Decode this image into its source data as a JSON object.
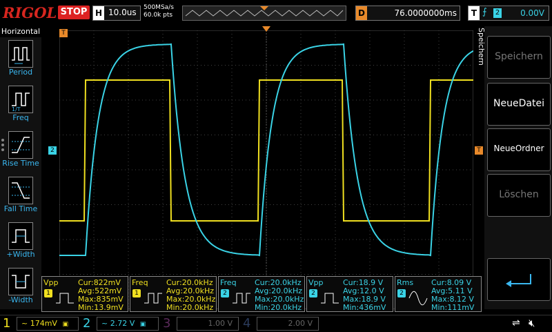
{
  "topbar": {
    "logo": "RIGOL",
    "run_state": "STOP",
    "h_label": "H",
    "timebase": "10.0us",
    "sample_rate": "500MSa/s",
    "sample_points": "60.0k pts",
    "d_label": "D",
    "delay": "76.0000000ms",
    "t_label": "T",
    "trigger_edge_icon": "rising-edge-icon",
    "trigger_source": "2",
    "trigger_level": "0.00V"
  },
  "left_menu": {
    "title": "Horizontal",
    "items": [
      {
        "label": "Period",
        "icon": "period-icon"
      },
      {
        "label": "Freq",
        "icon": "freq-icon"
      },
      {
        "label": "Rise Time",
        "icon": "rise-time-icon"
      },
      {
        "label": "Fall Time",
        "icon": "fall-time-icon"
      },
      {
        "label": "+Width",
        "icon": "pos-width-icon"
      },
      {
        "label": "-Width",
        "icon": "neg-width-icon"
      }
    ]
  },
  "right_menu": {
    "title": "Speichern",
    "buttons": [
      {
        "label": "Speichern",
        "enabled": false
      },
      {
        "label": "NeueDatei",
        "enabled": true
      },
      {
        "label": "NeueOrdner",
        "enabled": true
      },
      {
        "label": "Löschen",
        "enabled": false
      },
      {
        "label": "",
        "icon": "enter-arrow-icon",
        "enabled": true
      }
    ]
  },
  "measurements": [
    {
      "name": "Vpp",
      "channel": "1",
      "color": "#f0e020",
      "cur": "Cur:822mV",
      "avg": "Avg:522mV",
      "max": "Max:835mV",
      "min": "Min:13.9mV"
    },
    {
      "name": "Freq",
      "channel": "1",
      "color": "#f0e020",
      "cur": "Cur:20.0kHz",
      "avg": "Avg:20.0kHz",
      "max": "Max:20.0kHz",
      "min": "Min:20.0kHz"
    },
    {
      "name": "Freq",
      "channel": "2",
      "color": "#3ad3e6",
      "cur": "Cur:20.0kHz",
      "avg": "Avg:20.0kHz",
      "max": "Max:20.0kHz",
      "min": "Min:20.0kHz"
    },
    {
      "name": "Vpp",
      "channel": "2",
      "color": "#3ad3e6",
      "cur": "Cur:18.9 V",
      "avg": "Avg:12.0 V",
      "max": "Max:18.9 V",
      "min": "Min:436mV"
    },
    {
      "name": "Rms",
      "channel": "2",
      "color": "#3ad3e6",
      "cur": "Cur:8.09 V",
      "avg": "Avg:5.11 V",
      "max": "Max:8.12 V",
      "min": "Min:111mV"
    }
  ],
  "channels": [
    {
      "num": "1",
      "scale": "174mV",
      "color": "#f0e020"
    },
    {
      "num": "2",
      "scale": "2.72 V",
      "color": "#3ad3e6"
    },
    {
      "num": "3",
      "scale": "1.00 V",
      "color": "#b030b0"
    },
    {
      "num": "4",
      "scale": "2.00 V",
      "color": "#3070d0"
    }
  ],
  "markers": {
    "ch1_marker": "1",
    "ch2_marker": "2",
    "trigger_marker": "T"
  },
  "colors": {
    "ch1": "#f0e020",
    "ch2": "#3ad3e6",
    "accent_orange": "#e8892a",
    "stop_red": "#d22222",
    "menu_blue": "#3ab7f0"
  }
}
